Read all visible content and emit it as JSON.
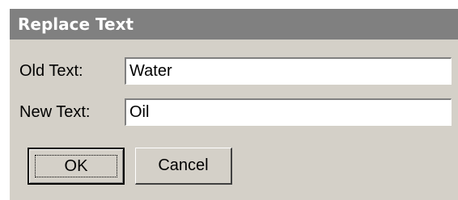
{
  "dialog": {
    "title": "Replace Text",
    "old_text_label": "Old Text:",
    "old_text_value": "Water",
    "new_text_label": "New Text:",
    "new_text_value": "Oil",
    "ok_label": "OK",
    "cancel_label": "Cancel"
  }
}
